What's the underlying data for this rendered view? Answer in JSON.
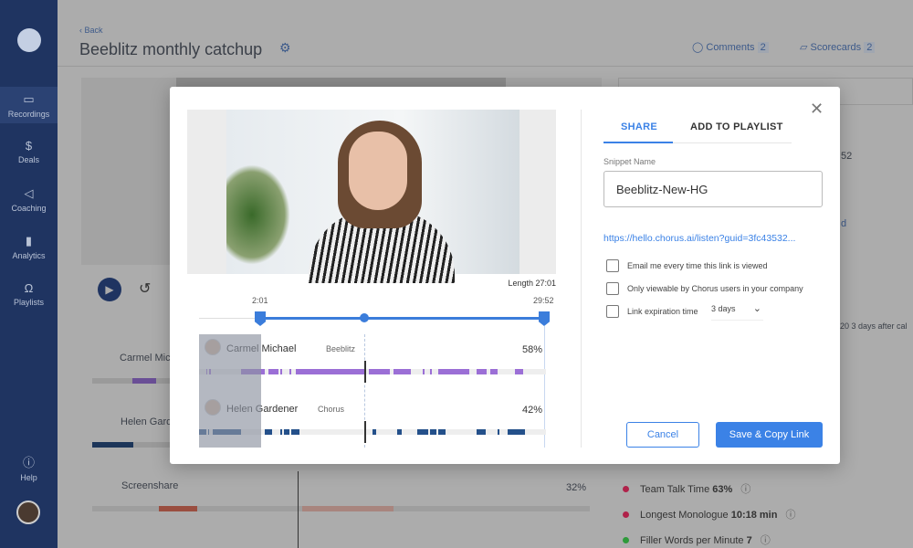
{
  "sidebar": {
    "items": [
      {
        "label": "Recordings",
        "icon": "video-icon"
      },
      {
        "label": "Deals",
        "icon": "money-bag-icon"
      },
      {
        "label": "Coaching",
        "icon": "megaphone-icon"
      },
      {
        "label": "Analytics",
        "icon": "bar-chart-icon"
      },
      {
        "label": "Playlists",
        "icon": "headphones-icon"
      }
    ],
    "help": "Help"
  },
  "header": {
    "back": "‹ Back",
    "title": "Beeblitz monthly catchup",
    "comments_label": "Comments",
    "comments_count": "2",
    "scorecards_label": "Scorecards",
    "scorecards_count": "2"
  },
  "background": {
    "participants": [
      "Carmel Mic",
      "Helen Gard"
    ],
    "screenshare": "Screenshare",
    "screenshare_pct": "32%",
    "side_partial_1": "52",
    "side_partial_2": "d",
    "side_partial_3": "20 3 days after cal",
    "metrics": [
      {
        "label": "Team Talk Time",
        "value": "63%",
        "color": "#b0224a"
      },
      {
        "label": "Longest Monologue",
        "value": "10:18 min",
        "color": "#b0224a"
      },
      {
        "label": "Filler Words per Minute",
        "value": "7",
        "color": "#2e9a3a"
      }
    ]
  },
  "modal": {
    "length": "Length 27:01",
    "start": "2:01",
    "end": "29:52",
    "speakers": [
      {
        "name": "Carmel Michael",
        "company": "Beeblitz",
        "pct": "58%",
        "color": "#9b6fd6",
        "segments": [
          [
            0.02,
            0.025
          ],
          [
            0.03,
            0.035
          ],
          [
            0.12,
            0.19
          ],
          [
            0.2,
            0.23
          ],
          [
            0.235,
            0.24
          ],
          [
            0.26,
            0.265
          ],
          [
            0.28,
            0.48
          ],
          [
            0.49,
            0.55
          ],
          [
            0.56,
            0.61
          ],
          [
            0.645,
            0.65
          ],
          [
            0.665,
            0.67
          ],
          [
            0.69,
            0.78
          ],
          [
            0.8,
            0.83
          ],
          [
            0.84,
            0.86
          ],
          [
            0.91,
            0.935
          ]
        ]
      },
      {
        "name": "Helen Gardener",
        "company": "Chorus",
        "pct": "42%",
        "color": "#24508a",
        "segments": [
          [
            0,
            0.02
          ],
          [
            0.025,
            0.03
          ],
          [
            0.04,
            0.12
          ],
          [
            0.19,
            0.21
          ],
          [
            0.235,
            0.24
          ],
          [
            0.245,
            0.26
          ],
          [
            0.265,
            0.29
          ],
          [
            0.5,
            0.51
          ],
          [
            0.57,
            0.585
          ],
          [
            0.63,
            0.66
          ],
          [
            0.665,
            0.685
          ],
          [
            0.69,
            0.71
          ],
          [
            0.8,
            0.825
          ],
          [
            0.86,
            0.867
          ],
          [
            0.89,
            0.94
          ]
        ]
      }
    ],
    "tabs": [
      "SHARE",
      "ADD TO PLAYLIST"
    ],
    "snippet_label": "Snippet Name",
    "snippet_value": "Beeblitz-New-HG",
    "link": "https://hello.chorus.ai/listen?guid=3fc43532...",
    "options": [
      "Email me every time this link is viewed",
      "Only viewable by Chorus users in your company",
      "Link expiration time"
    ],
    "expiration": "3 days",
    "cancel": "Cancel",
    "save": "Save & Copy Link",
    "accent": "#3b82e6"
  }
}
